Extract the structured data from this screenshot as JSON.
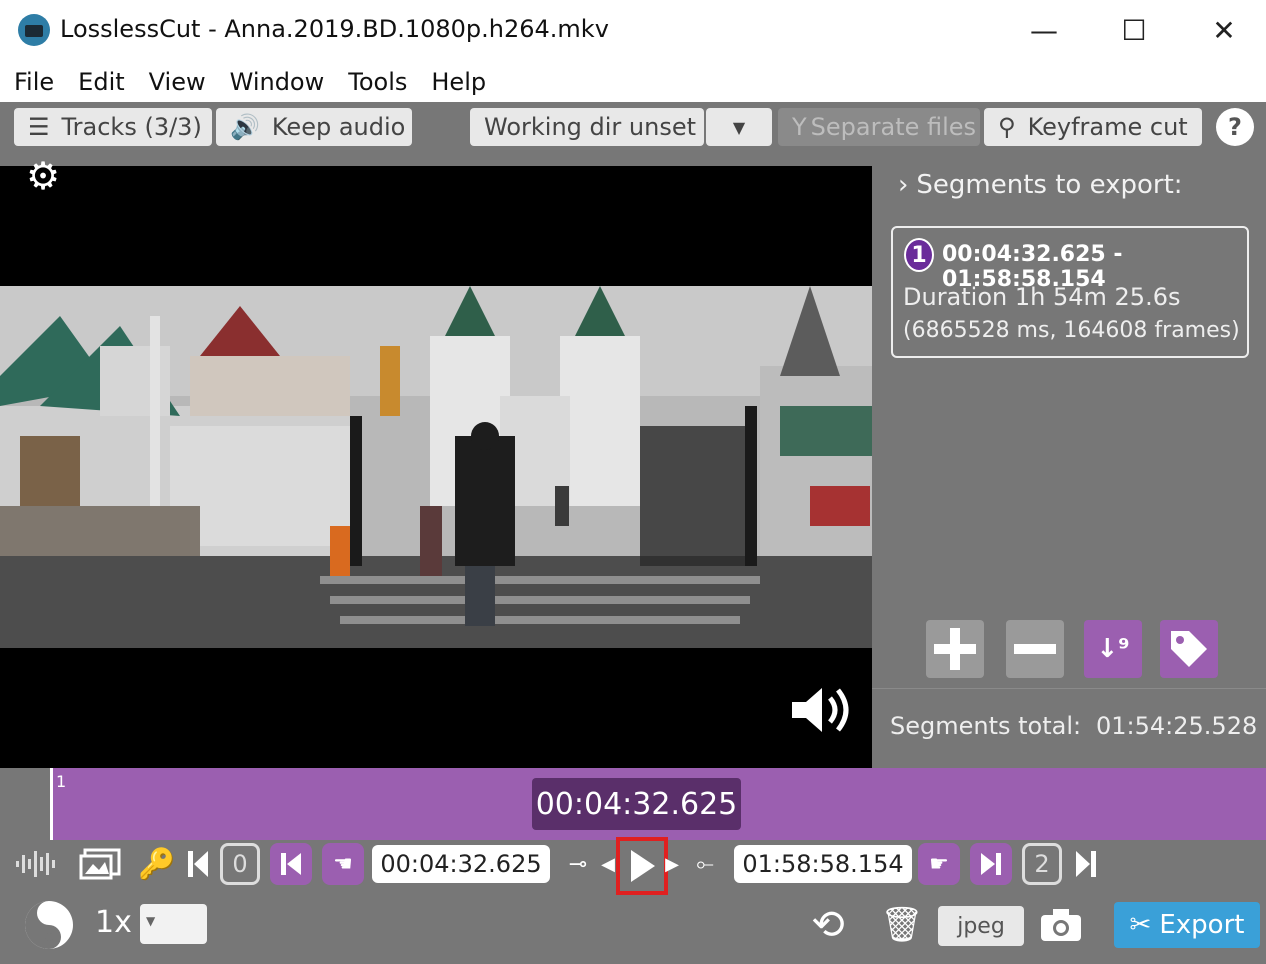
{
  "window": {
    "title": "LosslessCut - Anna.2019.BD.1080p.h264.mkv",
    "controls": {
      "minimize": "—",
      "maximize": "☐",
      "close": "✕"
    }
  },
  "menu": {
    "items": [
      "File",
      "Edit",
      "View",
      "Window",
      "Tools",
      "Help"
    ]
  },
  "toolbar": {
    "tracks_label": "Tracks (3/3)",
    "audio_label": "Keep audio",
    "working_dir_label": "Working dir unset",
    "separate_files_label": "Separate files",
    "keyframe_cut_label": "Keyframe cut",
    "help_label": "?"
  },
  "segments": {
    "header": "Segments to export:",
    "list": [
      {
        "number": "1",
        "range": "00:04:32.625 - 01:58:58.154",
        "duration": "Duration 1h 54m 25.6s",
        "detail": "(6865528 ms, 164608 frames)"
      }
    ],
    "total_label": "Segments total:",
    "total_value": "01:54:25.528"
  },
  "timeline": {
    "segment_label": "1",
    "current_time": "00:04:32.625"
  },
  "controls": {
    "cut_start_time": "00:04:32.625",
    "cut_end_time": "01:58:58.154",
    "start_seg_number": "0",
    "end_seg_number": "2",
    "speed_label": "1x",
    "capture_format": "jpeg",
    "export_label": "Export"
  },
  "colors": {
    "accent_purple": "#9b5fb0",
    "export_blue": "#3aa0d8",
    "panel_gray": "#777777"
  }
}
